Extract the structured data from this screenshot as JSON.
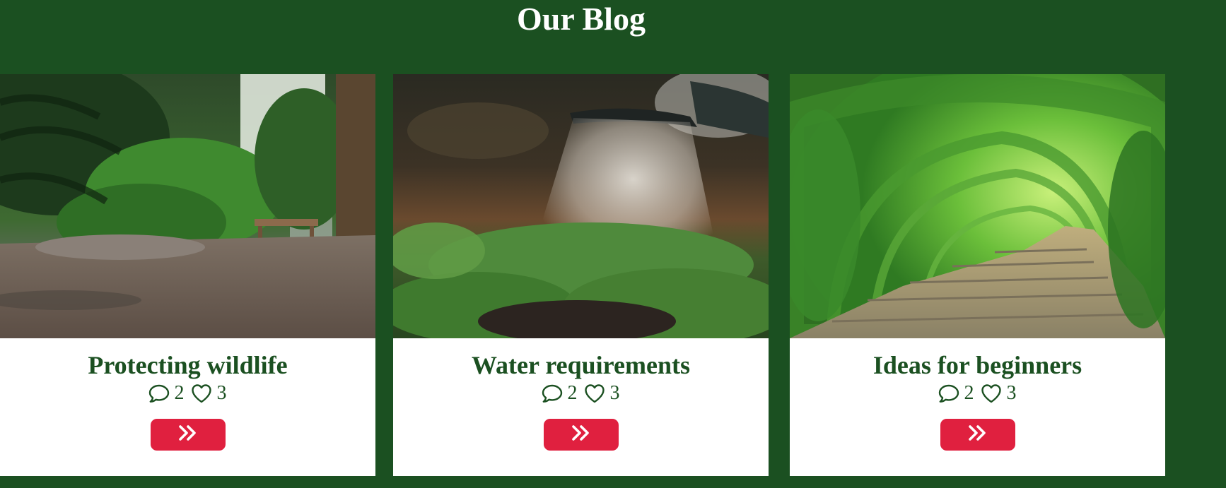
{
  "page": {
    "title": "Our Blog"
  },
  "colors": {
    "background": "#1b5021",
    "card_background": "#ffffff",
    "title_text": "#1b5021",
    "button": "#e0203f",
    "button_icon": "#ffffff"
  },
  "posts": [
    {
      "title": "Protecting wildlife",
      "image_name": "garden-path-plants-image",
      "comments": "2",
      "likes": "3",
      "comment_icon": "comment-icon",
      "like_icon": "heart-icon",
      "button_icon": "double-chevron-right-icon"
    },
    {
      "title": "Water requirements",
      "image_name": "watering-can-spray-image",
      "comments": "2",
      "likes": "3",
      "comment_icon": "comment-icon",
      "like_icon": "heart-icon",
      "button_icon": "double-chevron-right-icon"
    },
    {
      "title": "Ideas for beginners",
      "image_name": "green-arch-tunnel-image",
      "comments": "2",
      "likes": "3",
      "comment_icon": "comment-icon",
      "like_icon": "heart-icon",
      "button_icon": "double-chevron-right-icon"
    }
  ]
}
